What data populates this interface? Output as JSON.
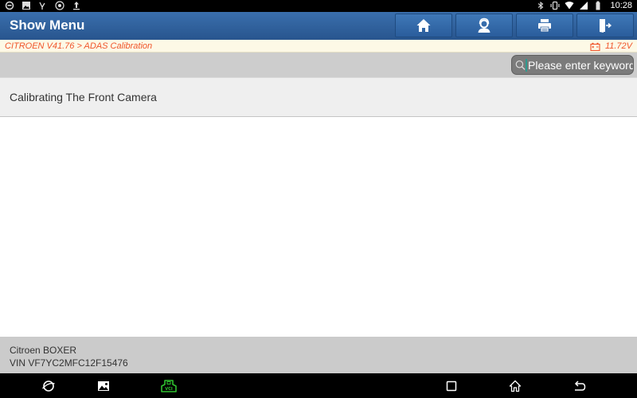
{
  "statusbar": {
    "left_icons": [
      "chat-icon",
      "image-icon",
      "usb-icon",
      "settings-icon",
      "upload-icon"
    ],
    "right_icons": [
      "bluetooth-icon",
      "vibrate-icon",
      "wifi-icon",
      "signal-icon",
      "battery-icon"
    ],
    "time": "10:28"
  },
  "header": {
    "title": "Show Menu",
    "buttons": [
      {
        "name": "home",
        "icon": "home-icon"
      },
      {
        "name": "support",
        "icon": "headset-icon"
      },
      {
        "name": "print",
        "icon": "printer-icon"
      },
      {
        "name": "exit",
        "icon": "exit-icon"
      }
    ]
  },
  "breadcrumb": {
    "path": "CITROEN V41.76 > ADAS Calibration",
    "voltage": "11.72V"
  },
  "search": {
    "placeholder": "Please enter keyword",
    "value": ""
  },
  "menu": {
    "items": [
      {
        "label": "Calibrating The Front Camera"
      }
    ]
  },
  "vehicle": {
    "model": "Citroen BOXER",
    "vin": "VIN VF7YC2MFC12F15476"
  },
  "colors": {
    "accent": "#2a5d9c",
    "breadcrumb_text": "#f0552b",
    "vci_green": "#2fc12f"
  }
}
